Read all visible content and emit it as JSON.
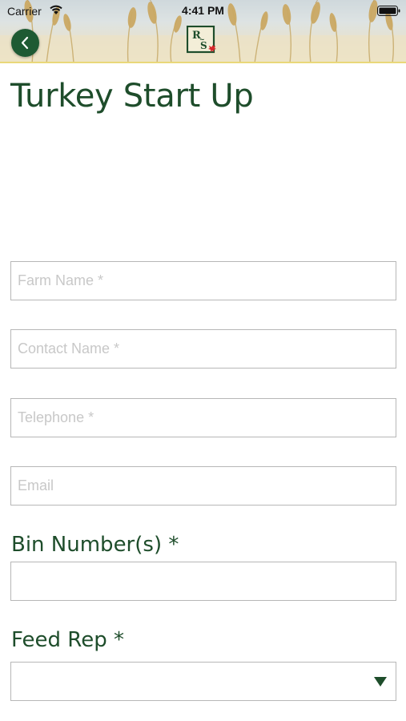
{
  "status_bar": {
    "carrier": "Carrier",
    "time": "4:41 PM",
    "icons": [
      "wifi-icon",
      "battery-icon"
    ]
  },
  "header": {
    "back_icon": "chevron-left-icon",
    "logo_text_top": "R",
    "logo_text_bottom": "S",
    "logo_mark": "~",
    "background": "wheat-field"
  },
  "page": {
    "title": "Turkey Start Up"
  },
  "form": {
    "farm_name": {
      "placeholder": "Farm Name *",
      "value": ""
    },
    "contact_name": {
      "placeholder": "Contact Name *",
      "value": ""
    },
    "telephone": {
      "placeholder": "Telephone *",
      "value": ""
    },
    "email": {
      "placeholder": "Email",
      "value": ""
    },
    "bin_numbers": {
      "label": "Bin Number(s) *",
      "value": ""
    },
    "feed_rep": {
      "label": "Feed Rep *",
      "selected": "",
      "icon": "triangle-down-icon"
    }
  },
  "colors": {
    "brand_green": "#1e4d2b",
    "button_green": "#1e5a33",
    "divider_yellow": "#e9d87a",
    "field_border": "#b7b7b7",
    "placeholder": "#c8c8c8"
  }
}
